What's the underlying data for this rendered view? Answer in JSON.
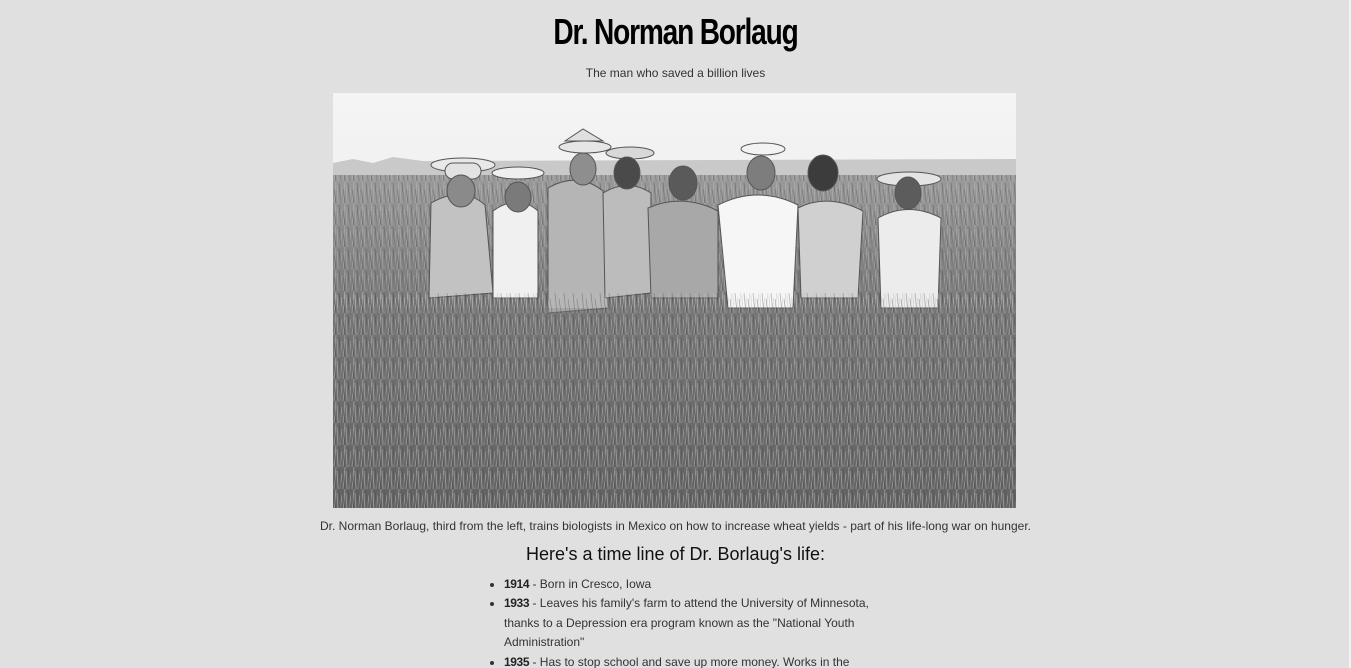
{
  "header": {
    "title": "Dr. Norman Borlaug",
    "subtitle": "The man who saved a billion lives"
  },
  "image": {
    "alt": "Dr. Norman Borlaug with biologists in a wheat field",
    "caption": "Dr. Norman Borlaug, third from the left, trains biologists in Mexico on how to increase wheat yields - part of his life-long war on hunger."
  },
  "tribute": {
    "heading": "Here's a time line of Dr. Borlaug's life:",
    "items": [
      {
        "year": "1914",
        "text": " - Born in Cresco, Iowa"
      },
      {
        "year": "1933",
        "text": " - Leaves his family's farm to attend the University of Minnesota, thanks to a Depression era program known as the \"National Youth Administration\""
      },
      {
        "year": "1935",
        "text": " - Has to stop school and save up more money. Works in the"
      }
    ]
  },
  "colors": {
    "background": "#e0e0e0",
    "title": "#000000",
    "text": "#333333"
  }
}
